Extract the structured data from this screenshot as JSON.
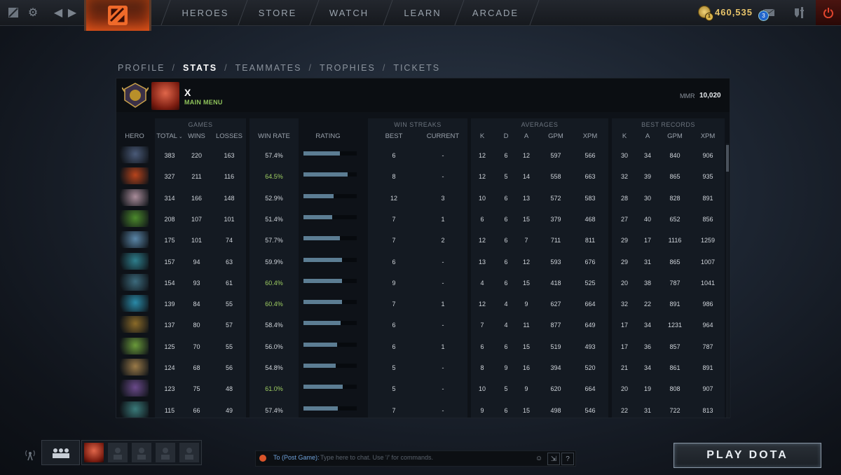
{
  "topbar": {
    "nav": [
      "HEROES",
      "STORE",
      "WATCH",
      "LEARN",
      "ARCADE"
    ],
    "gold": "460,535",
    "gold_badge": "1",
    "message_badge": "3"
  },
  "breadcrumb": {
    "items": [
      "PROFILE",
      "STATS",
      "TEAMMATES",
      "TROPHIES",
      "TICKETS"
    ],
    "active": "STATS",
    "separator": "/"
  },
  "profile": {
    "name": "X",
    "status": "MAIN MENU",
    "mmr_label": "MMR",
    "mmr_value": "10,020"
  },
  "table": {
    "group_headers": {
      "games": "GAMES",
      "win_streaks": "WIN STREAKS",
      "averages": "AVERAGES",
      "best_records": "BEST RECORDS"
    },
    "columns": {
      "hero": "HERO",
      "total": "TOTAL",
      "wins": "WINS",
      "losses": "LOSSES",
      "win_rate": "WIN RATE",
      "rating": "RATING",
      "best": "BEST",
      "current": "CURRENT",
      "k": "K",
      "d": "D",
      "a": "A",
      "gpm": "GPM",
      "xpm": "XPM",
      "rk": "K",
      "ra": "A",
      "rgpm": "GPM",
      "rxpm": "XPM"
    },
    "rows": [
      {
        "hero_color": "#4a5a78",
        "total": "383",
        "wins": "220",
        "losses": "163",
        "win_rate": "57.4%",
        "green": false,
        "rating": 0.68,
        "best": "6",
        "current": "-",
        "k": "12",
        "d": "6",
        "a": "12",
        "gpm": "597",
        "xpm": "566",
        "rk": "30",
        "ra": "34",
        "rgpm": "840",
        "rxpm": "906"
      },
      {
        "hero_color": "#b8441c",
        "total": "327",
        "wins": "211",
        "losses": "116",
        "win_rate": "64.5%",
        "green": true,
        "rating": 0.83,
        "best": "8",
        "current": "-",
        "k": "12",
        "d": "5",
        "a": "14",
        "gpm": "558",
        "xpm": "663",
        "rk": "32",
        "ra": "39",
        "rgpm": "865",
        "rxpm": "935"
      },
      {
        "hero_color": "#a98c9a",
        "total": "314",
        "wins": "166",
        "losses": "148",
        "win_rate": "52.9%",
        "green": false,
        "rating": 0.57,
        "best": "12",
        "current": "3",
        "k": "10",
        "d": "6",
        "a": "13",
        "gpm": "572",
        "xpm": "583",
        "rk": "28",
        "ra": "30",
        "rgpm": "828",
        "rxpm": "891"
      },
      {
        "hero_color": "#4c8a2c",
        "total": "208",
        "wins": "107",
        "losses": "101",
        "win_rate": "51.4%",
        "green": false,
        "rating": 0.54,
        "best": "7",
        "current": "1",
        "k": "6",
        "d": "6",
        "a": "15",
        "gpm": "379",
        "xpm": "468",
        "rk": "27",
        "ra": "40",
        "rgpm": "652",
        "rxpm": "856"
      },
      {
        "hero_color": "#5a86a8",
        "total": "175",
        "wins": "101",
        "losses": "74",
        "win_rate": "57.7%",
        "green": false,
        "rating": 0.68,
        "best": "7",
        "current": "2",
        "k": "12",
        "d": "6",
        "a": "7",
        "gpm": "711",
        "xpm": "811",
        "rk": "29",
        "ra": "17",
        "rgpm": "1116",
        "rxpm": "1259"
      },
      {
        "hero_color": "#2e7e8c",
        "total": "157",
        "wins": "94",
        "losses": "63",
        "win_rate": "59.9%",
        "green": false,
        "rating": 0.72,
        "best": "6",
        "current": "-",
        "k": "13",
        "d": "6",
        "a": "12",
        "gpm": "593",
        "xpm": "676",
        "rk": "29",
        "ra": "31",
        "rgpm": "865",
        "rxpm": "1007"
      },
      {
        "hero_color": "#3c6a7c",
        "total": "154",
        "wins": "93",
        "losses": "61",
        "win_rate": "60.4%",
        "green": true,
        "rating": 0.73,
        "best": "9",
        "current": "-",
        "k": "4",
        "d": "6",
        "a": "15",
        "gpm": "418",
        "xpm": "525",
        "rk": "20",
        "ra": "38",
        "rgpm": "787",
        "rxpm": "1041"
      },
      {
        "hero_color": "#2a8aa8",
        "total": "139",
        "wins": "84",
        "losses": "55",
        "win_rate": "60.4%",
        "green": true,
        "rating": 0.73,
        "best": "7",
        "current": "1",
        "k": "12",
        "d": "4",
        "a": "9",
        "gpm": "627",
        "xpm": "664",
        "rk": "32",
        "ra": "22",
        "rgpm": "891",
        "rxpm": "986"
      },
      {
        "hero_color": "#8a6a28",
        "total": "137",
        "wins": "80",
        "losses": "57",
        "win_rate": "58.4%",
        "green": false,
        "rating": 0.7,
        "best": "6",
        "current": "-",
        "k": "7",
        "d": "4",
        "a": "11",
        "gpm": "877",
        "xpm": "649",
        "rk": "17",
        "ra": "34",
        "rgpm": "1231",
        "rxpm": "964"
      },
      {
        "hero_color": "#6a9a3a",
        "total": "125",
        "wins": "70",
        "losses": "55",
        "win_rate": "56.0%",
        "green": false,
        "rating": 0.63,
        "best": "6",
        "current": "1",
        "k": "6",
        "d": "6",
        "a": "15",
        "gpm": "519",
        "xpm": "493",
        "rk": "17",
        "ra": "36",
        "rgpm": "857",
        "rxpm": "787"
      },
      {
        "hero_color": "#9a7a48",
        "total": "124",
        "wins": "68",
        "losses": "56",
        "win_rate": "54.8%",
        "green": false,
        "rating": 0.61,
        "best": "5",
        "current": "-",
        "k": "8",
        "d": "9",
        "a": "16",
        "gpm": "394",
        "xpm": "520",
        "rk": "21",
        "ra": "34",
        "rgpm": "861",
        "rxpm": "891"
      },
      {
        "hero_color": "#6a4a8a",
        "total": "123",
        "wins": "75",
        "losses": "48",
        "win_rate": "61.0%",
        "green": true,
        "rating": 0.74,
        "best": "5",
        "current": "-",
        "k": "10",
        "d": "5",
        "a": "9",
        "gpm": "620",
        "xpm": "664",
        "rk": "20",
        "ra": "19",
        "rgpm": "808",
        "rxpm": "907"
      },
      {
        "hero_color": "#3a7a7a",
        "total": "115",
        "wins": "66",
        "losses": "49",
        "win_rate": "57.4%",
        "green": false,
        "rating": 0.64,
        "best": "7",
        "current": "-",
        "k": "9",
        "d": "6",
        "a": "15",
        "gpm": "498",
        "xpm": "546",
        "rk": "22",
        "ra": "31",
        "rgpm": "722",
        "rxpm": "813"
      }
    ]
  },
  "chat": {
    "channel": "To (Post Game):",
    "placeholder": "Type here to chat. Use '/' for commands.",
    "help": "?"
  },
  "play_button": "PLAY DOTA",
  "colors": {
    "accent_gold": "#e8c46a",
    "win_rate_green": "#9fcf62",
    "rating_bar": "#5c7d93",
    "status_green": "#8ec25a"
  }
}
